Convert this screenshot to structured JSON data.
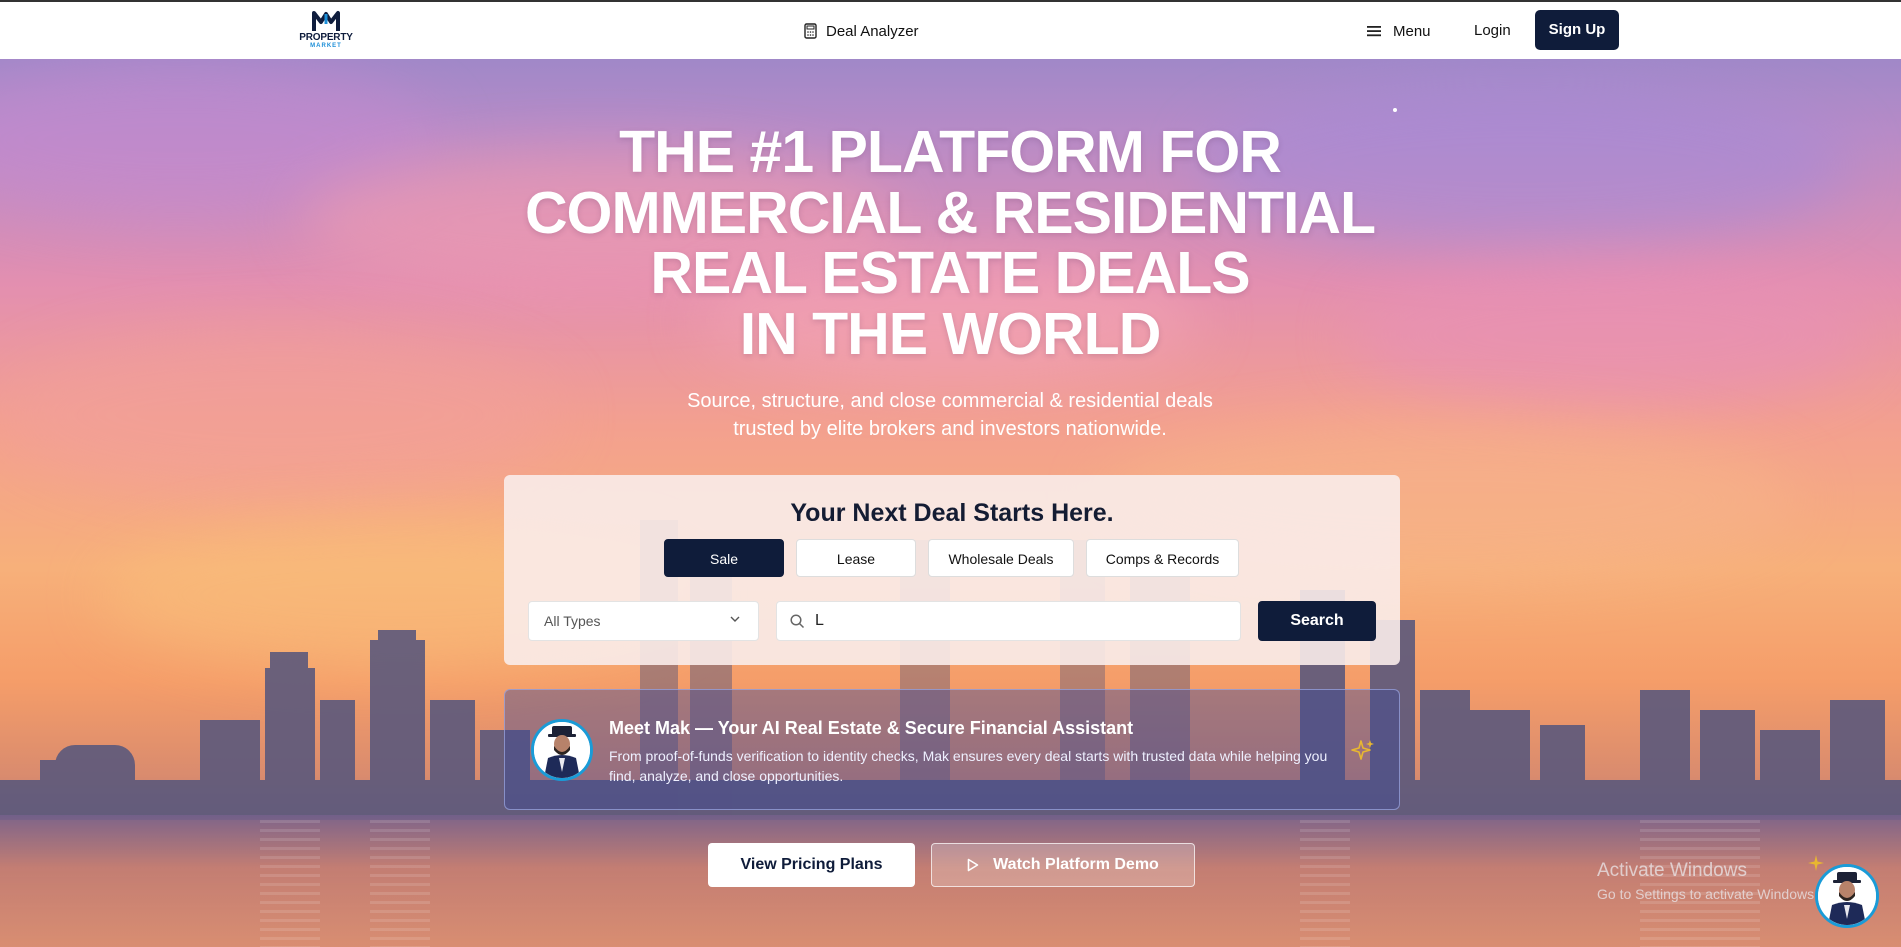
{
  "header": {
    "logo_brand": "PROPERTY",
    "logo_sub": "MARKET",
    "deal_analyzer": "Deal Analyzer",
    "menu": "Menu",
    "login": "Login",
    "signup": "Sign Up"
  },
  "hero": {
    "title_lines": [
      "THE #1 PLATFORM FOR",
      "COMMERCIAL & RESIDENTIAL",
      "REAL ESTATE DEALS",
      "IN THE WORLD"
    ],
    "subtitle_lines": [
      "Source, structure, and close commercial & residential deals",
      "trusted by elite brokers and investors nationwide."
    ]
  },
  "search_card": {
    "title": "Your Next Deal Starts Here.",
    "tabs": [
      {
        "label": "Sale",
        "active": true
      },
      {
        "label": "Lease",
        "active": false
      },
      {
        "label": "Wholesale Deals",
        "active": false
      },
      {
        "label": "Comps & Records",
        "active": false
      }
    ],
    "type_select": "All Types",
    "search_value": "L",
    "search_button": "Search"
  },
  "mak": {
    "title": "Meet Mak — Your AI Real Estate & Secure Financial Assistant",
    "description": "From proof-of-funds verification to identity checks, Mak ensures every deal starts with trusted data while helping you find, analyze, and close opportunities."
  },
  "buttons": {
    "pricing": "View Pricing Plans",
    "demo": "Watch Platform Demo"
  },
  "watermark": {
    "line1": "Activate Windows",
    "line2": "Go to Settings to activate Windows."
  },
  "colors": {
    "navy": "#0f1c3a",
    "accent_blue": "#1a9bd7",
    "gold": "#e8b730"
  },
  "icons": [
    "calculator-icon",
    "hamburger-menu-icon",
    "chevron-down-icon",
    "search-icon",
    "sparkle-icon",
    "play-icon"
  ]
}
